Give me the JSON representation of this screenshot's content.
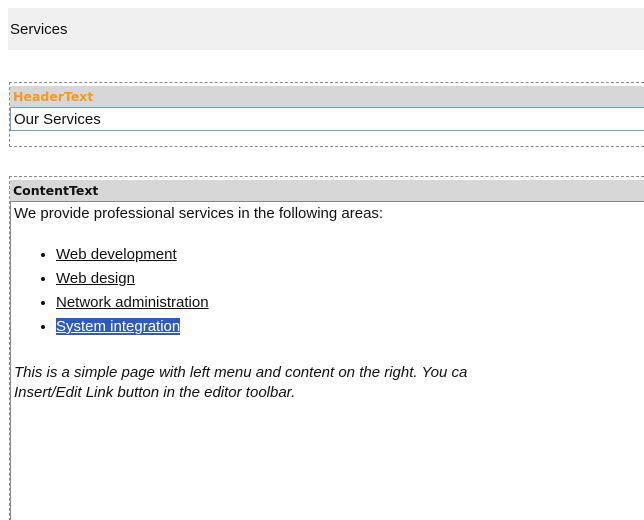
{
  "title_bar": {
    "label": "Services"
  },
  "header_field": {
    "label": "HeaderText",
    "value": "Our Services"
  },
  "content_field": {
    "label": "ContentText",
    "intro": "We provide professional services in the following areas:",
    "links": [
      {
        "text": "Web development",
        "selected": false
      },
      {
        "text": "Web design",
        "selected": false
      },
      {
        "text": "Network administration",
        "selected": false
      },
      {
        "text": "System integration",
        "selected": true
      }
    ],
    "note_line1": "This is a simple page with left menu and content on the right. You ca",
    "note_line2": "Insert/Edit Link button in the editor toolbar."
  },
  "colors": {
    "header_label": "#f39a1f",
    "selection": "#2f5ac0"
  }
}
